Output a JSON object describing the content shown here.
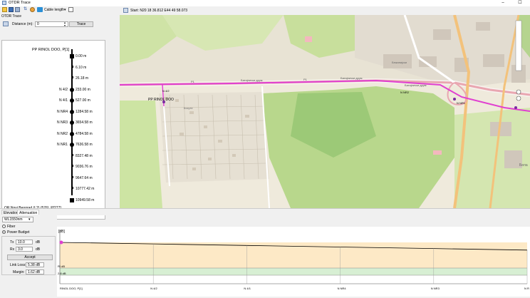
{
  "window": {
    "title": "OTDR Trace",
    "minimize": "–",
    "maximize": "☐"
  },
  "toolbar": {
    "cable_length_label": "Cable length"
  },
  "left": {
    "panel_label": "OTDR Trace",
    "distance_label": "Distance (m):",
    "distance_value": "0",
    "trace_button": "Trace"
  },
  "schematic": {
    "top_label": "PP RINOL DOO, P[1]",
    "bottom_label": "OR Novi Beograd (L2) (576), P[277]",
    "entries": [
      {
        "name": "",
        "dist": "0.00 m",
        "kind": "square"
      },
      {
        "name": "",
        "dist": "6.10 m",
        "kind": "small"
      },
      {
        "name": "",
        "dist": "26.18 m",
        "kind": "small"
      },
      {
        "name": "N 4/2",
        "dist": "233.00 m",
        "kind": "circle"
      },
      {
        "name": "N 4/1",
        "dist": "527.00 m",
        "kind": "circle"
      },
      {
        "name": "N NR4",
        "dist": "1284.58 m",
        "kind": "circle"
      },
      {
        "name": "N NR3",
        "dist": "3654.58 m",
        "kind": "circle"
      },
      {
        "name": "N NR2",
        "dist": "4784.58 m",
        "kind": "circle"
      },
      {
        "name": "N NR1",
        "dist": "7636.58 m",
        "kind": "circle"
      },
      {
        "name": "",
        "dist": "8327.48 m",
        "kind": "small"
      },
      {
        "name": "",
        "dist": "9036.76 m",
        "kind": "small"
      },
      {
        "name": "",
        "dist": "9647.64 m",
        "kind": "small"
      },
      {
        "name": "",
        "dist": "10777.42 m",
        "kind": "small"
      },
      {
        "name": "",
        "dist": "10949.58 m",
        "kind": "square"
      }
    ]
  },
  "map": {
    "start_coord": "Start: N20 18 36.812 E44 49 58.073",
    "labels": {
      "pp_rinol": "PP RINOL DOO",
      "n42": "N 4/2",
      "road1": "Батајнички друм",
      "road2": "Батајнички друм",
      "road3": "Батајнички друм",
      "r1": "Р1",
      "r2": "Р1",
      "nr1": "N NR1",
      "nr2": "N NR2",
      "kosute": "Косуте",
      "bahnhof": "Бежанијски",
      "bela": "Бела"
    }
  },
  "tabs": {
    "elevation": "Elevation",
    "attenuation": "Attenuation"
  },
  "attenuation": {
    "wavelength": "WL1550nm",
    "fiber_label": "Fiber",
    "power_budget_label": "Power Budget",
    "tx_label": "Tx",
    "tx_value": "10.0",
    "tx_unit": "dB",
    "rx_label": "Rx",
    "rx_value": "3.0",
    "rx_unit": "dB",
    "accept_button": "Accept",
    "link_loss_label": "Link Loss:",
    "link_loss_value": "5.38 dB",
    "margin_label": "Margin:",
    "margin_value": "1.62 dB"
  },
  "chart_data": {
    "type": "line",
    "ylabel": "[dB]",
    "xlabels": [
      "RINOL DOO, P[1]",
      "N 4/2",
      "N 4/1",
      "N NR4",
      "N NR3",
      "N R"
    ],
    "series": [
      {
        "values": [
          0,
          0.6,
          1.2,
          1.8,
          2.4,
          3.0
        ]
      }
    ],
    "markers": [
      "RI dB",
      "2.8 dB"
    ]
  },
  "colors": {
    "accent": "#2a6fd6",
    "route": "#e040d0",
    "budget_fill": "#fde9c6",
    "margin_fill": "#d7efd3"
  }
}
